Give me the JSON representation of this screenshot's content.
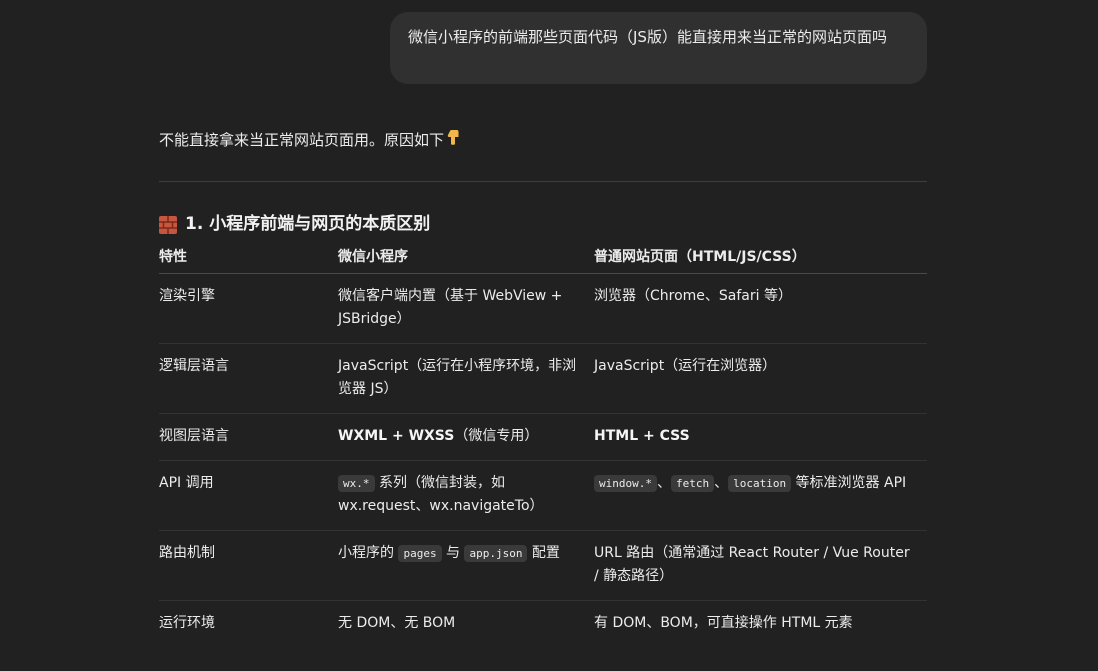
{
  "user_message": "微信小程序的前端那些页面代码（JS版）能直接用来当正常的网站页面吗",
  "assistant": {
    "intro": "不能直接拿来当正常网站页面用。原因如下",
    "intro_icon": "pointing-down-hand-icon",
    "section_icon": "brick-icon",
    "section_heading": "1. 小程序前端与网页的本质区别"
  },
  "table": {
    "headers": [
      "特性",
      "微信小程序",
      "普通网站页面（HTML/JS/CSS）"
    ],
    "rows": [
      {
        "feature": "渲染引擎",
        "miniprogram": "微信客户端内置（基于 WebView + JSBridge）",
        "web": "浏览器（Chrome、Safari 等）"
      },
      {
        "feature": "逻辑层语言",
        "miniprogram": "JavaScript（运行在小程序环境，非浏览器 JS）",
        "web": "JavaScript（运行在浏览器）"
      },
      {
        "feature": "视图层语言",
        "miniprogram_bold": "WXML + WXSS",
        "miniprogram_rest": "（微信专用）",
        "web_bold": "HTML + CSS"
      },
      {
        "feature": "API 调用",
        "miniprogram_code": "wx.*",
        "miniprogram_rest": " 系列（微信封装，如 wx.request、wx.navigateTo）",
        "web_code1": "window.*",
        "web_sep1": "、",
        "web_code2": "fetch",
        "web_sep2": "、",
        "web_code3": "location",
        "web_rest": " 等标准浏览器 API"
      },
      {
        "feature": "路由机制",
        "miniprogram_pre": "小程序的 ",
        "miniprogram_code1": "pages",
        "miniprogram_mid": " 与 ",
        "miniprogram_code2": "app.json",
        "miniprogram_post": " 配置",
        "web": "URL 路由（通常通过 React Router / Vue Router / 静态路径）"
      },
      {
        "feature": "运行环境",
        "miniprogram": "无 DOM、无 BOM",
        "web": "有 DOM、BOM，可直接操作 HTML 元素"
      }
    ]
  }
}
